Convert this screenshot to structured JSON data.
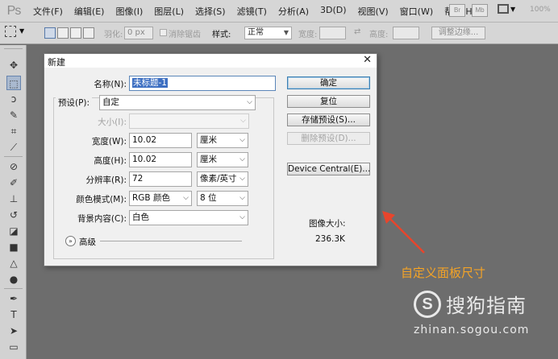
{
  "app": {
    "logo": "Ps"
  },
  "menu": [
    "文件(F)",
    "编辑(E)",
    "图像(I)",
    "图层(L)",
    "选择(S)",
    "滤镜(T)",
    "分析(A)",
    "3D(D)",
    "视图(V)",
    "窗口(W)",
    "帮助(H)"
  ],
  "menubar_right": {
    "br": "Br",
    "mb": "Mb",
    "zoom": "100%"
  },
  "options": {
    "feather_label": "羽化:",
    "feather_value": "0 px",
    "antialias_label": "消除锯齿",
    "style_label": "样式:",
    "style_value": "正常",
    "width_label": "宽度:",
    "height_label": "高度:",
    "refine_button": "调整边缘..."
  },
  "dialog": {
    "title": "新建",
    "name_label": "名称(N):",
    "name_value": "未标题-1",
    "preset_label": "预设(P):",
    "preset_value": "自定",
    "size_label": "大小(I):",
    "width_label": "宽度(W):",
    "width_value": "10.02",
    "width_unit": "厘米",
    "height_label": "高度(H):",
    "height_value": "10.02",
    "height_unit": "厘米",
    "resolution_label": "分辨率(R):",
    "resolution_value": "72",
    "resolution_unit": "像素/英寸",
    "color_mode_label": "颜色模式(M):",
    "color_mode_value": "RGB 颜色",
    "bit_depth_value": "8 位",
    "background_label": "背景内容(C):",
    "background_value": "白色",
    "advanced_label": "高级",
    "buttons": {
      "ok": "确定",
      "reset": "复位",
      "save_preset": "存储预设(S)...",
      "delete_preset": "删除预设(D)...",
      "device_central": "Device Central(E)..."
    },
    "image_size_label": "图像大小:",
    "image_size_value": "236.3K"
  },
  "annotation": "自定义面板尺寸",
  "watermark": {
    "brand": "搜狗指南",
    "url": "zhinan.sogou.com"
  },
  "colors": {
    "annotation": "#f4a326",
    "arrow": "#e8452c",
    "workspace": "#6d6d6d"
  }
}
